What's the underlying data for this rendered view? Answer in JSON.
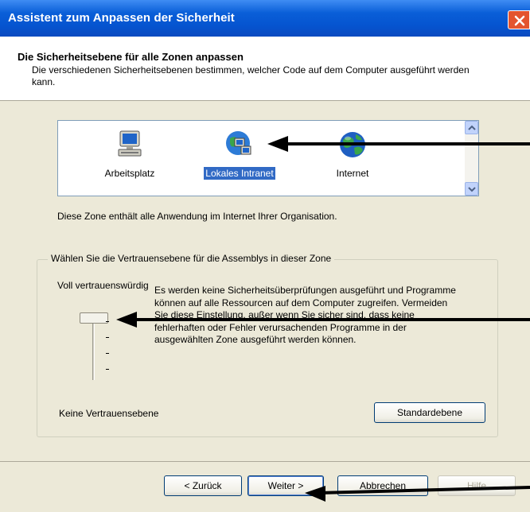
{
  "window": {
    "title": "Assistent zum Anpassen der Sicherheit"
  },
  "header": {
    "title": "Die Sicherheitsebene für alle Zonen anpassen",
    "description": "Die verschiedenen Sicherheitsebenen bestimmen, welcher Code auf dem Computer ausgeführt werden kann."
  },
  "zones": {
    "items": [
      {
        "label": "Arbeitsplatz",
        "icon": "computer-icon"
      },
      {
        "label": "Lokales Intranet",
        "icon": "intranet-icon",
        "selected": true
      },
      {
        "label": "Internet",
        "icon": "globe-icon"
      }
    ],
    "description": "Diese Zone enthält alle Anwendung im Internet Ihrer Organisation."
  },
  "trust": {
    "group_label": "Wählen Sie die Vertrauensebene für die Assemblys in dieser Zone",
    "top_label": "Voll vertrauenswürdig",
    "bottom_label": "Keine Vertrauensebene",
    "description": "Es werden keine Sicherheitsüberprüfungen ausgeführt und Programme können auf alle Ressourcen auf dem Computer zugreifen. Vermeiden Sie diese Einstellung, außer wenn Sie sicher sind, dass keine fehlerhaften oder Fehler verursachenden Programme in der ausgewählten Zone ausgeführt werden können.",
    "default_button": "Standardebene",
    "slider_level": "Voll vertrauenswürdig"
  },
  "buttons": {
    "back": "< Zurück",
    "next": "Weiter >",
    "cancel": "Abbrechen",
    "help": "Hilfe"
  },
  "colors": {
    "titlebar": "#0a5fd8",
    "selection": "#316ac5",
    "dialog_bg": "#ece9d8",
    "close_button": "#e3542f"
  }
}
